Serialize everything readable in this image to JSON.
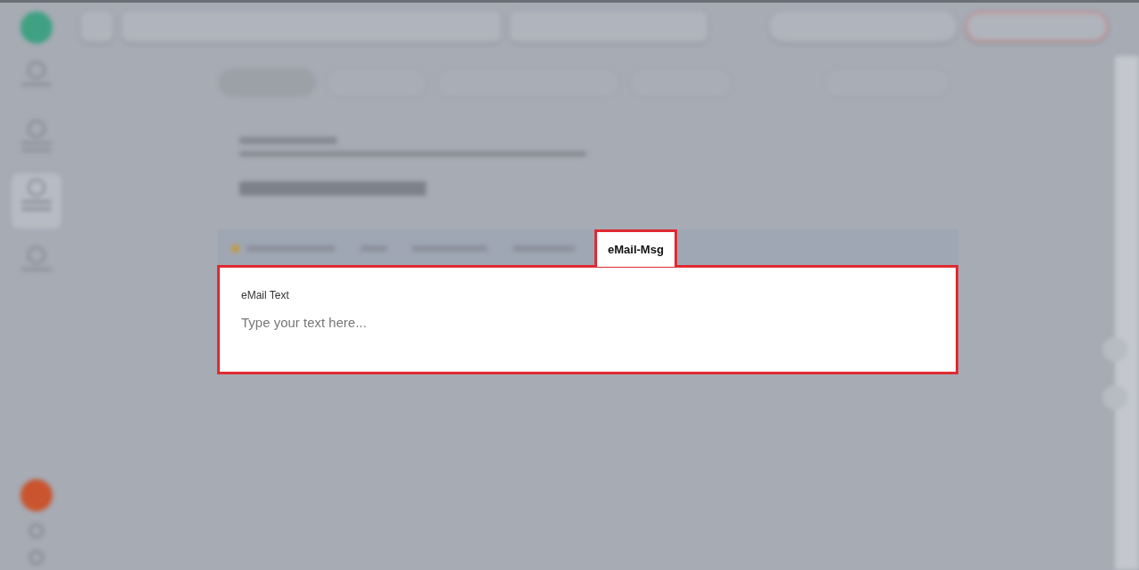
{
  "sidebar": {
    "items": [
      {
        "selected": false
      },
      {
        "selected": false
      },
      {
        "selected": true
      },
      {
        "selected": false
      }
    ]
  },
  "tabs": [
    {
      "selected": false,
      "dot": true
    },
    {
      "selected": false,
      "dot": false
    },
    {
      "selected": false,
      "dot": false
    },
    {
      "selected": false,
      "dot": false
    },
    {
      "label": "eMail-Msg",
      "selected": true
    }
  ],
  "email_field": {
    "label": "eMail Text",
    "placeholder": "Type your text here..."
  }
}
